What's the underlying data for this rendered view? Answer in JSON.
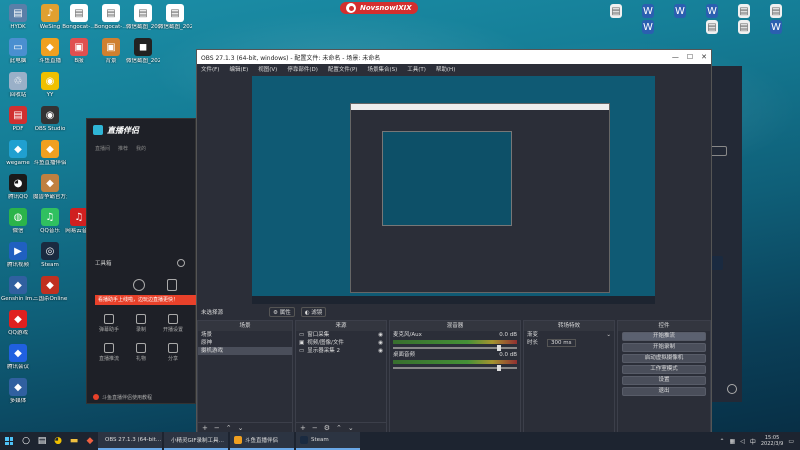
{
  "desktop": {
    "banner_title": "NovsnowIXIX",
    "icons_left": [
      {
        "label": "HYDK",
        "color": "#5a7fa8",
        "glyph": "▤"
      },
      {
        "label": "WeSing",
        "color": "#e0a030",
        "glyph": "♪"
      },
      {
        "label": "Bongocat-…",
        "color": "#ffffff",
        "glyph": "▤"
      },
      {
        "label": "Bongocat-…",
        "color": "#ffffff",
        "glyph": "▤"
      },
      {
        "label": "微信截图_2022…",
        "color": "#ffffff",
        "glyph": "▤"
      },
      {
        "label": "微信截图_2022…",
        "color": "#ffffff",
        "glyph": "▤"
      },
      {
        "label": "此电脑",
        "color": "#4a8fd0",
        "glyph": "▭"
      },
      {
        "label": "斗鱼直播",
        "color": "#f0a020",
        "glyph": "◆"
      },
      {
        "label": "B服",
        "color": "#e05050",
        "glyph": "▣"
      },
      {
        "label": "背景",
        "color": "#d08030",
        "glyph": "▣"
      },
      {
        "label": "微信截图_2022…",
        "color": "#222222",
        "glyph": "◼"
      },
      {
        "label": "回收站",
        "color": "#9ab0c8",
        "glyph": "♲"
      },
      {
        "label": "YY",
        "color": "#f0c000",
        "glyph": "◉"
      },
      {
        "label": "PDF",
        "color": "#d03030",
        "glyph": "▤"
      },
      {
        "label": "OBS Studio",
        "color": "#333333",
        "glyph": "◉"
      },
      {
        "label": "wegame",
        "color": "#20a0d0",
        "glyph": "◆"
      },
      {
        "label": "斗鱼直播伴侣",
        "color": "#f0a020",
        "glyph": "◆"
      },
      {
        "label": "腾讯QQ",
        "color": "#1a1a1a",
        "glyph": "◕"
      },
      {
        "label": "魔兽争霸官方对战平台",
        "color": "#c08040",
        "glyph": "◆"
      },
      {
        "label": "微信",
        "color": "#2bb44a",
        "glyph": "◍"
      },
      {
        "label": "QQ音乐",
        "color": "#30c060",
        "glyph": "♫"
      },
      {
        "label": "网易云音乐",
        "color": "#d02020",
        "glyph": "♫"
      },
      {
        "label": "腾讯视频",
        "color": "#2060c0",
        "glyph": "▶"
      },
      {
        "label": "Steam",
        "color": "#1a2a40",
        "glyph": "◎"
      },
      {
        "label": "Genshin Im…",
        "color": "#3060a0",
        "glyph": "◆"
      },
      {
        "label": "三国杀Online",
        "color": "#c03020",
        "glyph": "◆"
      },
      {
        "label": "QQ游戏",
        "color": "#e02020",
        "glyph": "◆"
      },
      {
        "label": "腾讯会议",
        "color": "#2060e0",
        "glyph": "◆"
      },
      {
        "label": "多媒体",
        "color": "#3060a0",
        "glyph": "◆"
      }
    ],
    "icons_right": [
      {
        "label": "",
        "color": "#f0f0f0",
        "glyph": "▤"
      },
      {
        "label": "",
        "color": "#2b5fb0",
        "glyph": "W"
      },
      {
        "label": "",
        "color": "#2b5fb0",
        "glyph": "W"
      },
      {
        "label": "",
        "color": "#2b5fb0",
        "glyph": "W"
      },
      {
        "label": "",
        "color": "#f0f0f0",
        "glyph": "▤"
      },
      {
        "label": "",
        "color": "#f0f0f0",
        "glyph": "▤"
      },
      {
        "label": "",
        "color": "#2b5fb0",
        "glyph": "W"
      },
      {
        "label": "",
        "color": "#f0f0f0",
        "glyph": "▤"
      },
      {
        "label": "",
        "color": "#f0f0f0",
        "glyph": "▤"
      },
      {
        "label": "",
        "color": "#2b5fb0",
        "glyph": "W"
      }
    ]
  },
  "obs": {
    "title": "OBS 27.1.3 (64-bit, windows) - 配置文件: 未命名 - 场景: 未命名",
    "menu": [
      "文件(F)",
      "编辑(E)",
      "视图(V)",
      "停靠部件(D)",
      "配置文件(P)",
      "场景集合(S)",
      "工具(T)",
      "帮助(H)"
    ],
    "toolbar_label": "未选择源",
    "toolbar_btn1": "属性",
    "toolbar_btn2": "滤镜",
    "scenes": {
      "header": "场景",
      "items": [
        "场景",
        "原神",
        "摄机游戏"
      ]
    },
    "sources": {
      "header": "来源",
      "items": [
        "窗口采集",
        "视频/图像/文件",
        "显示器采集 2"
      ]
    },
    "mixer": {
      "header": "混音器",
      "channels": [
        {
          "name": "麦克风/Aux",
          "db": "0.0 dB"
        },
        {
          "name": "桌面音频",
          "db": "0.0 dB"
        }
      ]
    },
    "transitions": {
      "header": "转场特效",
      "type": "渐变",
      "duration_label": "时长",
      "duration_value": "300 ms"
    },
    "controls": {
      "header": "控件",
      "buttons": [
        "开始推流",
        "开始录制",
        "启动虚拟摄像机",
        "工作室模式",
        "设置",
        "退出"
      ]
    }
  },
  "app_left": {
    "brand": "直播伴侣",
    "tabs": [
      "直播间",
      "推荐",
      "我的"
    ],
    "section": "工具箱",
    "banner": "看播助手上线啦，边玩边直播更快！",
    "grid": [
      "弹幕助手",
      "录制",
      "开播设置",
      "直播推流",
      "礼物",
      "分享"
    ],
    "bottom": "斗鱼直播伴侣使用教程"
  },
  "taskbar": {
    "tasks": [
      {
        "label": "OBS 27.1.3 (64-bit…",
        "color": "#333333"
      },
      {
        "label": "小精灵GIF录制工具…",
        "color": "#30b0a0"
      },
      {
        "label": "斗鱼直播伴侣",
        "color": "#f0a020"
      },
      {
        "label": "Steam",
        "color": "#1a2a40"
      }
    ],
    "time": "15:05",
    "date": "2022/3/9",
    "lang": "中"
  }
}
